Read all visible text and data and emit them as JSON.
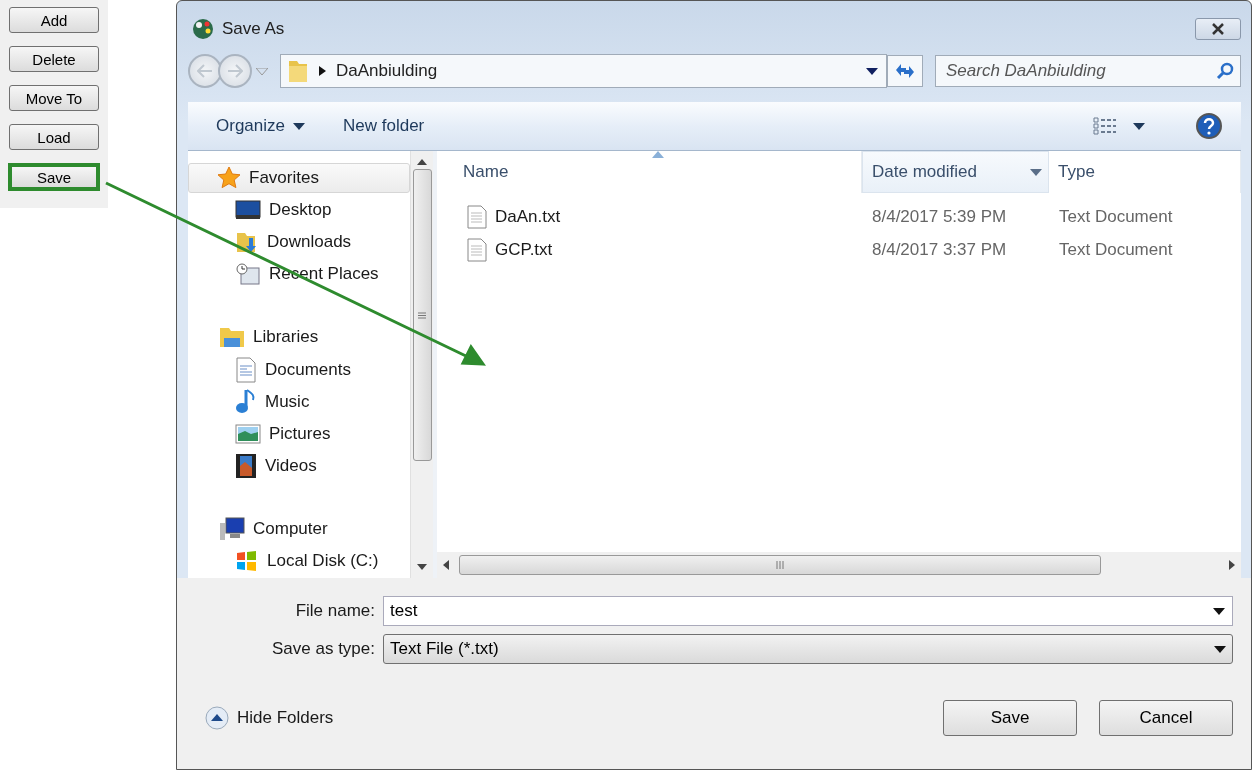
{
  "left_panel": {
    "buttons": [
      {
        "label": "Add",
        "highlighted": false
      },
      {
        "label": "Delete",
        "highlighted": false
      },
      {
        "label": "Move To",
        "highlighted": false
      },
      {
        "label": "Load",
        "highlighted": false
      },
      {
        "label": "Save",
        "highlighted": true
      }
    ]
  },
  "dialog": {
    "title": "Save As",
    "address": {
      "path": "DaAnbiulding"
    },
    "search": {
      "placeholder": "Search DaAnbiulding"
    },
    "toolbar": {
      "organize": "Organize",
      "new_folder": "New folder"
    },
    "nav_tree": [
      {
        "label": "Favorites",
        "selected": true,
        "children": [
          {
            "label": "Desktop",
            "selected": false
          },
          {
            "label": "Downloads",
            "selected": false
          },
          {
            "label": "Recent Places",
            "selected": false
          }
        ]
      },
      {
        "label": "Libraries",
        "selected": false,
        "children": [
          {
            "label": "Documents",
            "selected": false
          },
          {
            "label": "Music",
            "selected": false
          },
          {
            "label": "Pictures",
            "selected": false
          },
          {
            "label": "Videos",
            "selected": false
          }
        ]
      },
      {
        "label": "Computer",
        "selected": false,
        "children": [
          {
            "label": "Local Disk (C:)",
            "selected": false
          }
        ]
      }
    ],
    "columns": [
      {
        "label": "Name",
        "sorted": true,
        "highlighted": false
      },
      {
        "label": "Date modified",
        "sorted": false,
        "highlighted": true
      },
      {
        "label": "Type",
        "sorted": false,
        "highlighted": false
      }
    ],
    "files": [
      {
        "name": "DaAn.txt",
        "date": "8/4/2017 5:39 PM",
        "type": "Text Document"
      },
      {
        "name": "GCP.txt",
        "date": "8/4/2017 3:37 PM",
        "type": "Text Document"
      }
    ],
    "file_name": {
      "label": "File name:",
      "value": "test"
    },
    "save_type": {
      "label": "Save as type:",
      "value": "Text File (*.txt)"
    },
    "hide_folders": "Hide Folders",
    "buttons": [
      "Save",
      "Cancel"
    ]
  }
}
